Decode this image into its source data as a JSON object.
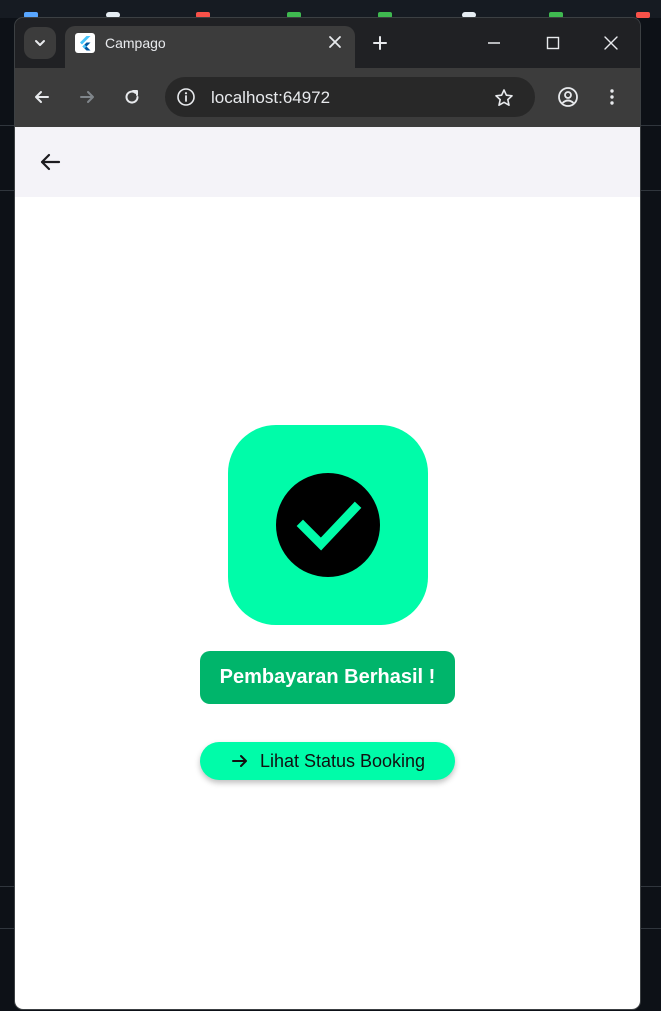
{
  "browser": {
    "tab_title": "Campago",
    "url": "localhost:64972"
  },
  "page": {
    "success_message": "Pembayaran Berhasil !",
    "status_button_label": "Lihat Status Booking"
  },
  "colors": {
    "accent": "#00fca9",
    "success_pill": "#00b56b",
    "appbar": "#f4f3f8"
  },
  "icons": {
    "back": "arrow-left-icon",
    "check": "check-circle-icon",
    "status_button": "arrow-right-icon"
  }
}
